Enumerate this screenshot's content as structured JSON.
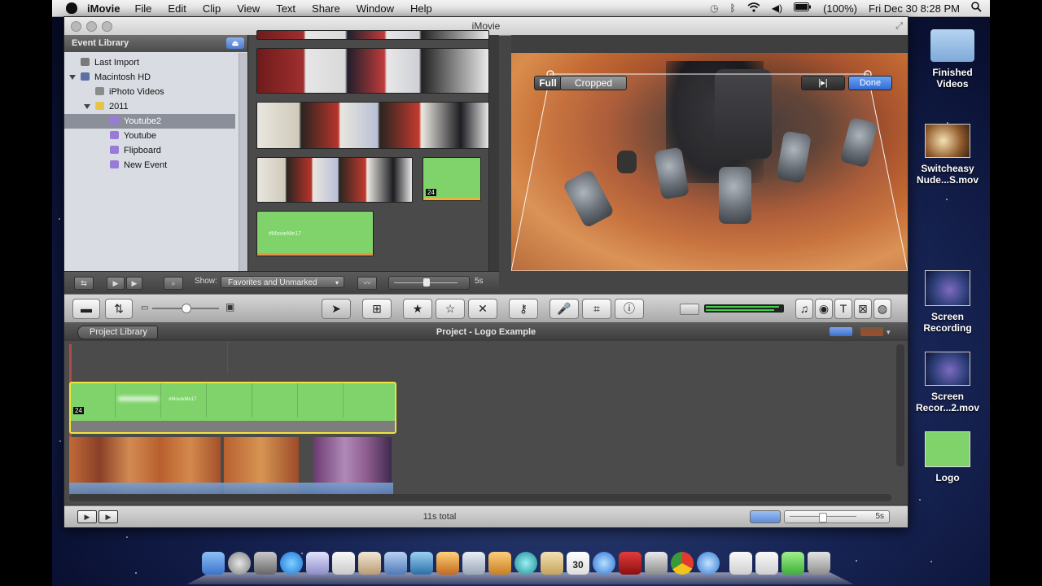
{
  "menubar": {
    "app_name": "iMovie",
    "items": [
      "File",
      "Edit",
      "Clip",
      "View",
      "Text",
      "Share",
      "Window",
      "Help"
    ],
    "battery": "(100%)",
    "clock": "Fri Dec 30  8:28 PM"
  },
  "window": {
    "title": "iMovie"
  },
  "event_library": {
    "header": "Event Library",
    "items": [
      {
        "label": "Last Import"
      },
      {
        "label": "Macintosh HD"
      },
      {
        "label": "iPhoto Videos"
      },
      {
        "label": "2011"
      },
      {
        "label": "Youtube2"
      },
      {
        "label": "Youtube"
      },
      {
        "label": "Flipboard"
      },
      {
        "label": "New Event"
      }
    ]
  },
  "event_browser": {
    "badge_24": "24",
    "clip_caption": "#MovieMe17"
  },
  "viewer": {
    "full_label": "Full",
    "cropped_label": "Cropped",
    "done_label": "Done",
    "play_label": "|▸|"
  },
  "event_toolbar": {
    "show_label": "Show:",
    "show_value": "Favorites and Unmarked",
    "duration": "5s"
  },
  "project": {
    "library_button": "Project Library",
    "title": "Project - Logo Example",
    "badge_24": "24",
    "clip_caption": "#MovieMe17"
  },
  "bottom_bar": {
    "total": "11s total",
    "duration": "5s"
  },
  "desktop": {
    "items": [
      {
        "label_line1": "Finished",
        "label_line2": "Videos"
      },
      {
        "label_line1": "Switcheasy",
        "label_line2": "Nude...S.mov"
      },
      {
        "label_line1": "Screen",
        "label_line2": "Recording"
      },
      {
        "label_line1": "Screen",
        "label_line2": "Recor...2.mov"
      },
      {
        "label_line1": "Logo",
        "label_line2": ""
      }
    ]
  },
  "dock": {
    "calendar_day": "30"
  },
  "colors": {
    "clip_green": "#7fd36a",
    "selection_yellow": "#f2e33a",
    "done_blue": "#3d7fe0"
  }
}
